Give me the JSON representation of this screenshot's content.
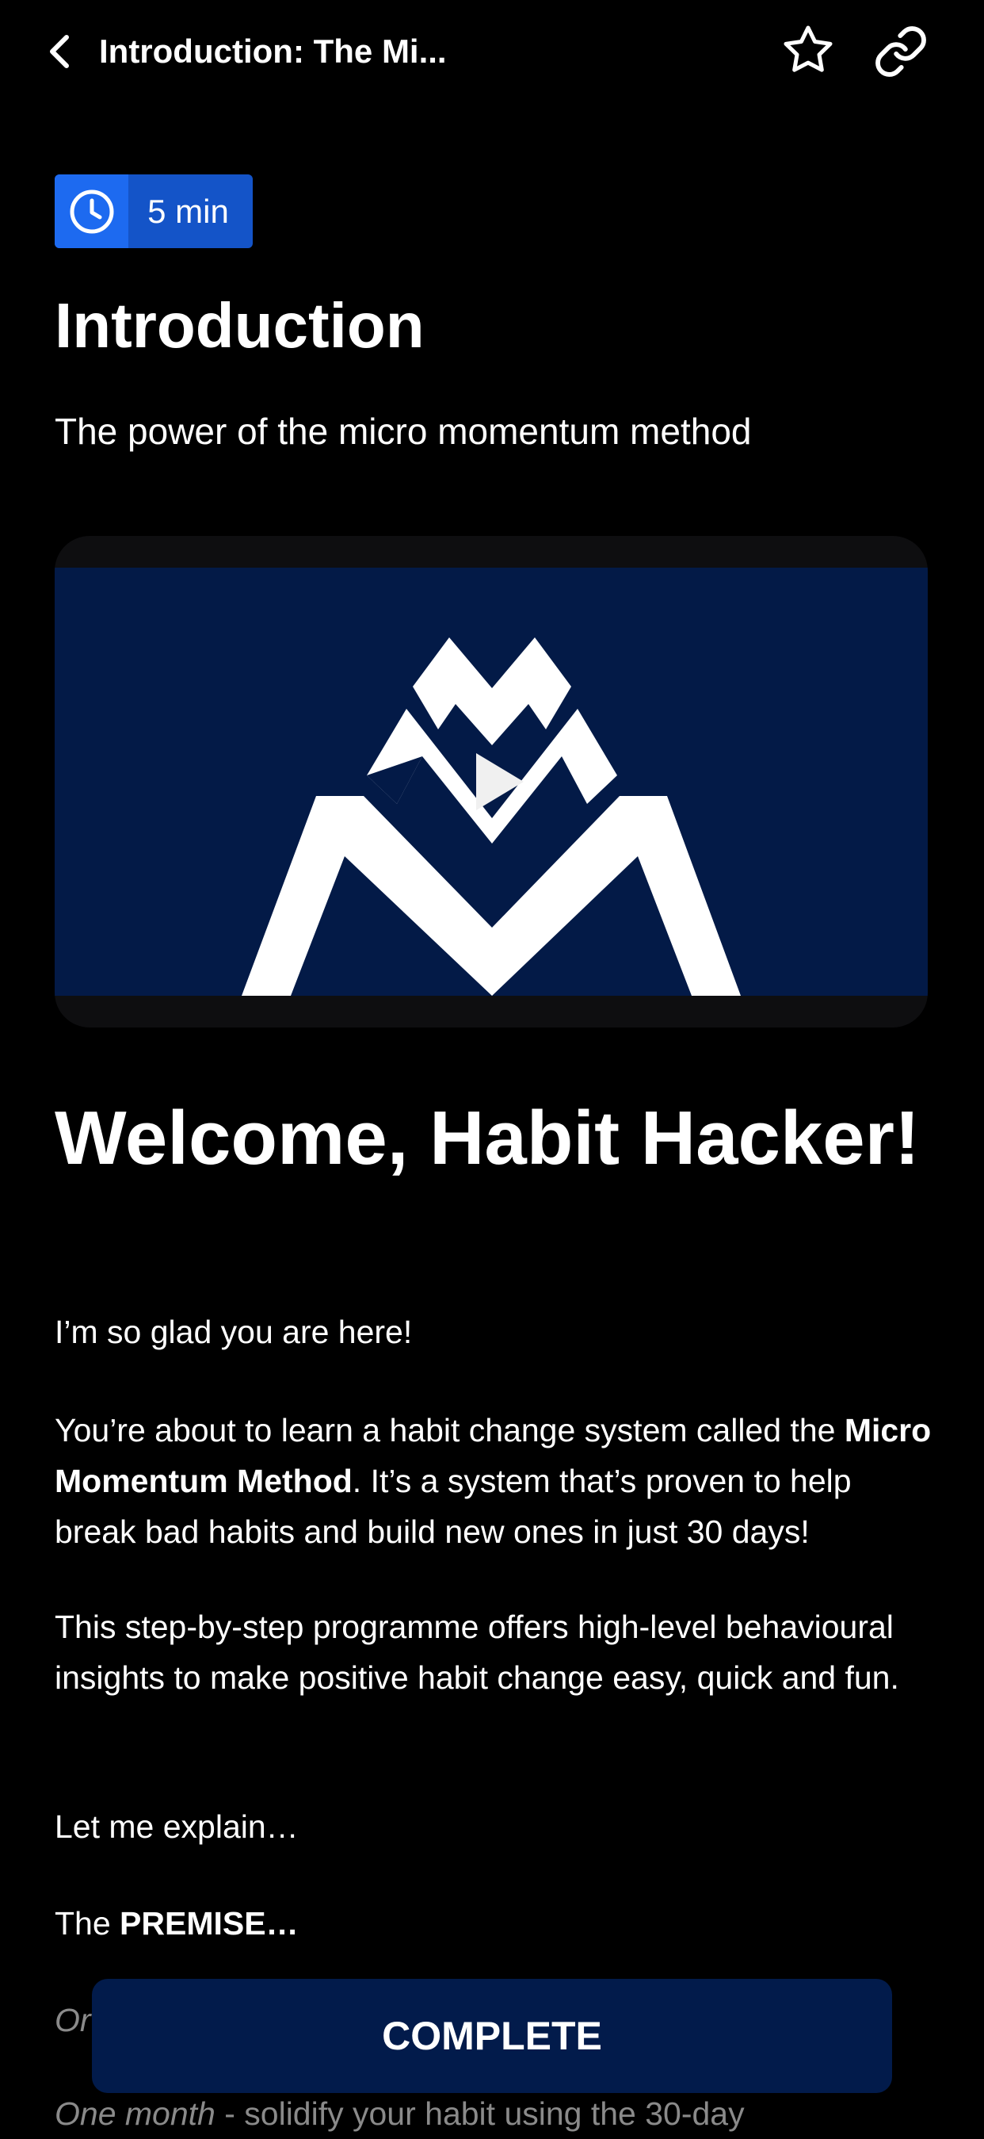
{
  "header": {
    "title": "Introduction: The Mi..."
  },
  "lesson": {
    "duration": "5 min",
    "title": "Introduction",
    "subtitle": "The power of the micro momentum method"
  },
  "content": {
    "heading": "Welcome, Habit Hacker!",
    "p1": "I’m so glad you are here!",
    "p2_start": "You’re about to learn a habit change system called the ",
    "p2_bold": "Micro Momentum Method",
    "p2_end": ". It’s a system that’s proven to help break bad habits and build new ones in just 30 days!",
    "p3": "This step-by-step programme offers high-level behavioural insights to make positive habit change easy, quick and fun.",
    "p4": "Let me explain…",
    "p5_start": "The ",
    "p5_bold": "PREMISE…",
    "p6_partial": "Or",
    "p7_italic": "One month",
    "p7_rest": " - solidify your habit using the 30-day"
  },
  "footer": {
    "complete_label": "COMPLETE"
  },
  "colors": {
    "background": "#000000",
    "badge": "#1454c8",
    "badge_icon_bg": "#1d6af0",
    "video_bg": "#031a47",
    "button_bg": "#021b4b"
  },
  "icons": {
    "back": "chevron-left-icon",
    "favorite": "star-icon",
    "share": "link-icon",
    "duration": "clock-icon",
    "video_logo": "mountain-logo-icon",
    "play": "play-icon"
  }
}
